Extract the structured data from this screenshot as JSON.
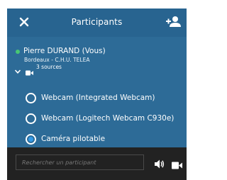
{
  "header": {
    "title": "Participants",
    "close_icon": "close-icon",
    "add_user_icon": "add-user-icon"
  },
  "participant": {
    "name": "Pierre DURAND (Vous)",
    "location": "Bordeaux - C.H.U. TELEA",
    "sources_label": "3 sources",
    "status_color": "#48c774",
    "sources": [
      {
        "label": "Webcam (Integrated Webcam)",
        "selected": false
      },
      {
        "label": "Webcam (Logitech Webcam C930e)",
        "selected": false
      },
      {
        "label": "Caméra pilotable",
        "selected": true
      }
    ]
  },
  "footer": {
    "search_placeholder": "Rechercher un participant",
    "speaker_icon": "speaker-icon",
    "camera_icon": "camera-icon"
  },
  "colors": {
    "panel": "#2d6b97",
    "header": "#286490",
    "footer": "#222222",
    "radio_selected": "#3399e6"
  }
}
